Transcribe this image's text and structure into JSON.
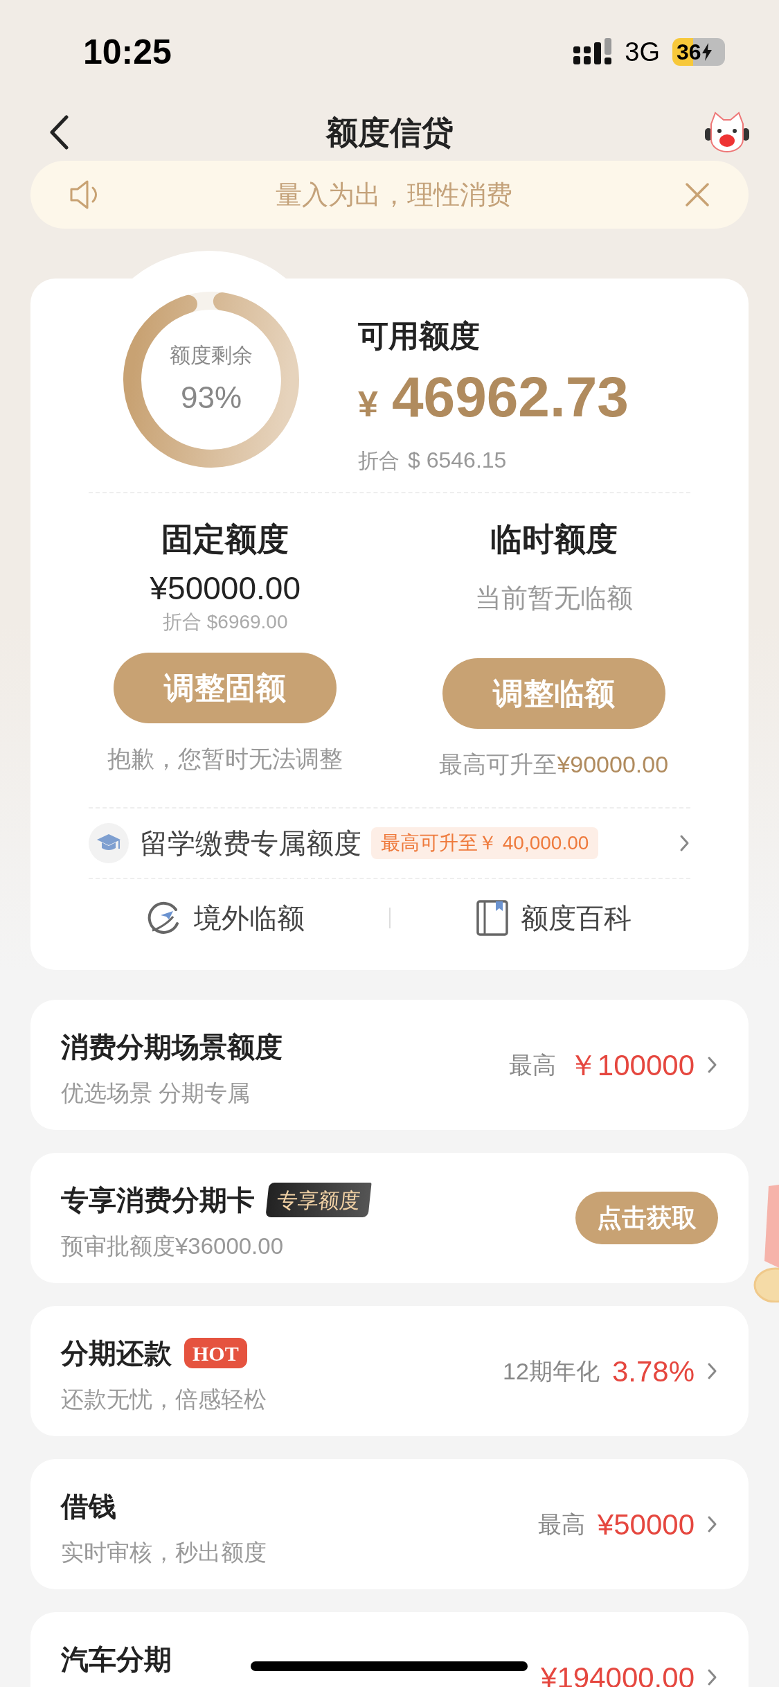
{
  "status_bar": {
    "time": "10:25",
    "network": "3G",
    "battery": "36"
  },
  "nav": {
    "title": "额度信贷"
  },
  "notice": {
    "text": "量入为出，理性消费"
  },
  "summary": {
    "ring_label": "额度剩余",
    "ring_value": "93%",
    "level": 0.93,
    "title": "可用额度",
    "currency": "¥",
    "amount": "46962.73",
    "converted_label": "折合",
    "converted": "$ 6546.15"
  },
  "quotas": [
    {
      "title": "固定额度",
      "amount": "¥50000.00",
      "converted": "折合 $6969.00",
      "button": "调整固额",
      "note": "抱歉，您暂时无法调整"
    },
    {
      "title": "临时额度",
      "status": "当前暂无临额",
      "button": "调整临额",
      "note": "最高可升至",
      "note_amount": "¥90000.00"
    }
  ],
  "study": {
    "label": "留学缴费专属额度",
    "tag": "最高可升至￥ 40,000.00"
  },
  "links": [
    {
      "kind": "plane",
      "label": "境外临额"
    },
    {
      "kind": "book",
      "label": "额度百科"
    }
  ],
  "products": [
    {
      "kind": "amount",
      "title": "消费分期场景额度",
      "subtitle": "优选场景 分期专属",
      "prefix": "最高",
      "value": "￥100000"
    },
    {
      "kind": "button",
      "title": "专享消费分期卡",
      "badge": {
        "kind": "dark",
        "text": "专享额度"
      },
      "subtitle": "预审批额度¥36000.00",
      "button": "点击获取"
    },
    {
      "kind": "amount",
      "title": "分期还款",
      "badge": {
        "kind": "hot",
        "text": "HOT"
      },
      "subtitle": "还款无忧，倍感轻松",
      "prefix": "12期年化",
      "value": "3.78%"
    },
    {
      "kind": "amount",
      "title": "借钱",
      "subtitle": "实时审核，秒出额度",
      "prefix": "最高",
      "value": "¥50000"
    },
    {
      "kind": "amount",
      "title": "汽车分期",
      "value": "¥194000.00"
    }
  ]
}
